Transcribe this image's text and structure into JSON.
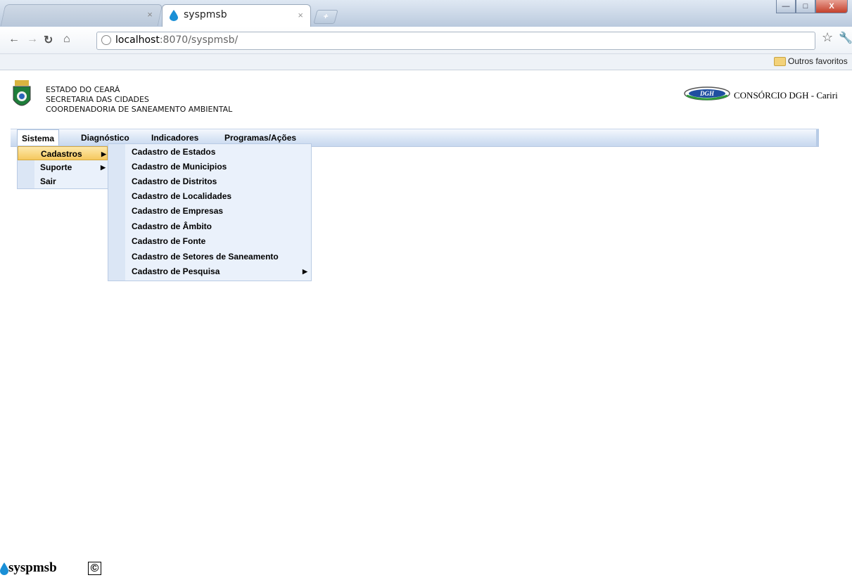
{
  "browser": {
    "active_tab_title": "syspmsb",
    "tab_close": "×",
    "new_tab": "+",
    "url_host": "localhost",
    "url_rest": ":8070/syspmsb/",
    "bookmark_folder": "Outros favoritos",
    "window_buttons": {
      "minimize": "—",
      "maximize": "□",
      "close": "X"
    }
  },
  "header": {
    "gov_lines": [
      "ESTADO DO CEARÁ",
      "SECRETARIA DAS CIDADES",
      "COORDENADORIA DE SANEAMENTO AMBIENTAL"
    ],
    "partner_text": "CONSÓRCIO DGH - Cariri",
    "partner_logo_text": "DGH"
  },
  "menubar": {
    "items": [
      "Sistema",
      "Diagnóstico",
      "Indicadores",
      "Programas/Ações"
    ]
  },
  "sistema_menu": {
    "items": [
      "Cadastros",
      "Suporte",
      "Sair"
    ]
  },
  "cadastros_menu": {
    "items": [
      "Cadastro de Estados",
      "Cadastro de Municipios",
      "Cadastro de Distritos",
      "Cadastro de Localidades",
      "Cadastro de Empresas",
      "Cadastro de Âmbito",
      "Cadastro de Fonte",
      "Cadastro de Setores de Saneamento",
      "Cadastro de Pesquisa"
    ]
  },
  "footer": {
    "app_name": "syspmsb",
    "copyright": "©"
  },
  "colors": {
    "menubar": "#d9e5f5",
    "menu_bg": "#eaf1fb",
    "highlight": "#f5c85e",
    "drop_blue": "#1a8fd6"
  }
}
